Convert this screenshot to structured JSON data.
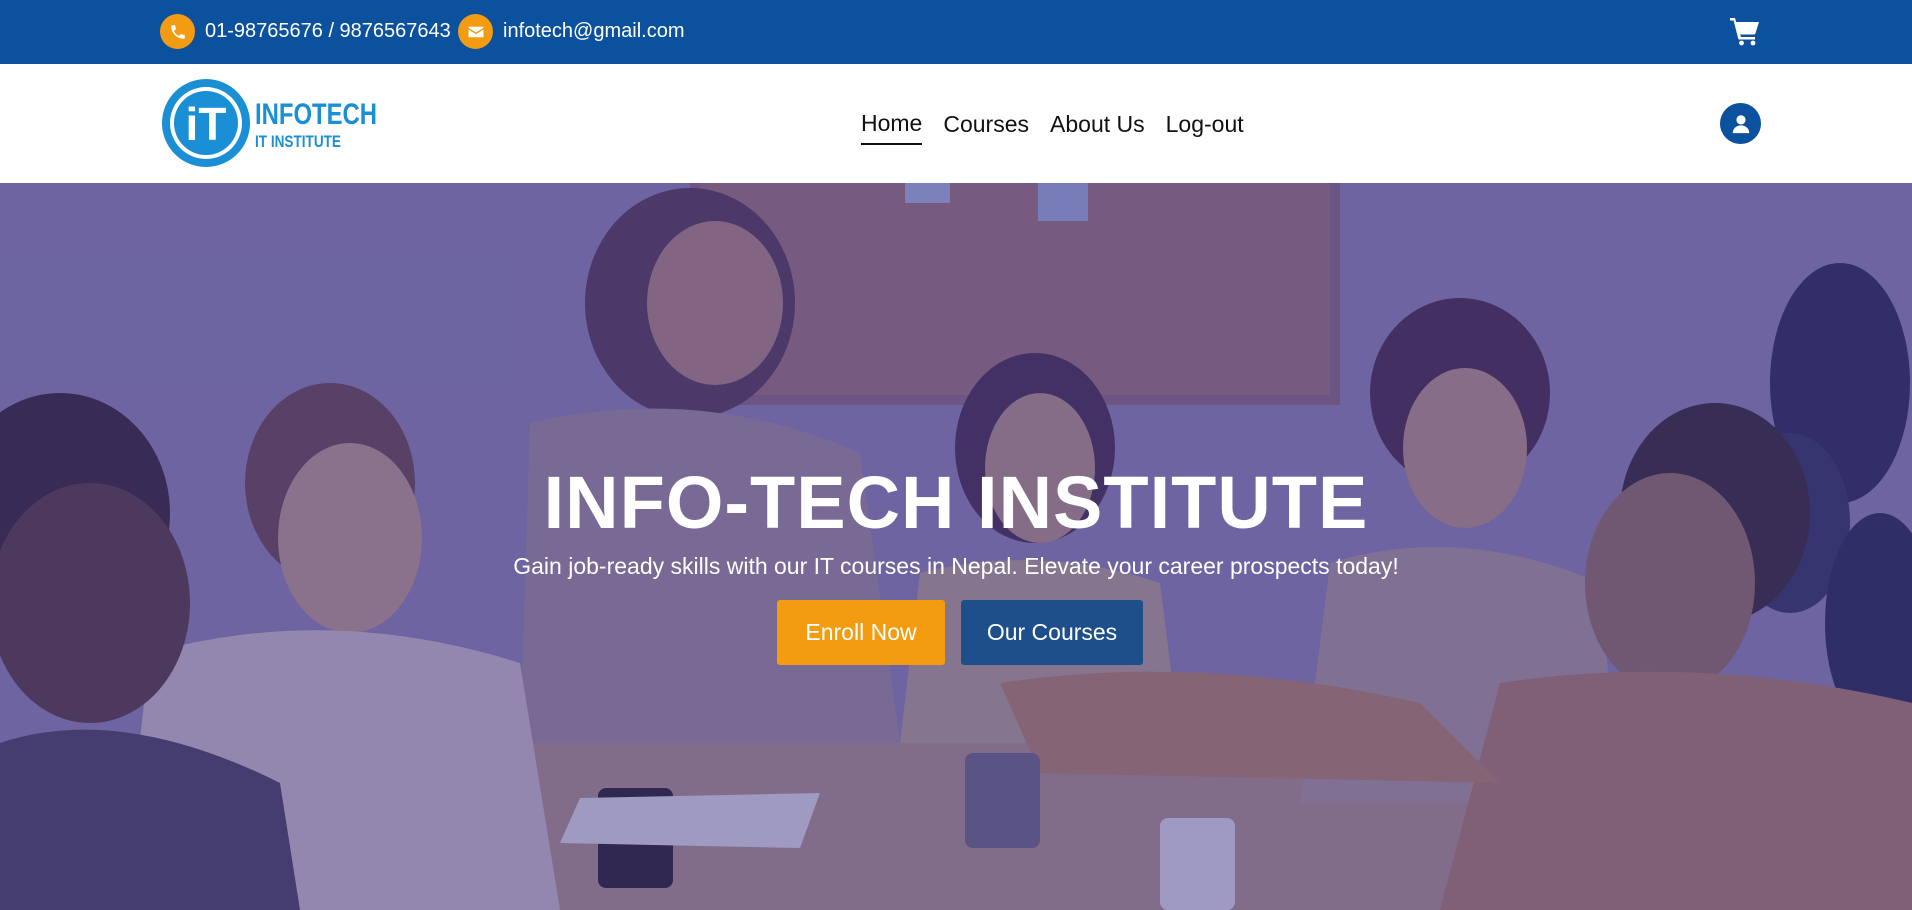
{
  "topbar": {
    "phone_icon": "phone-icon",
    "phone": "01-98765676 / 9876567643",
    "email_icon": "envelope-icon",
    "email": "infotech@gmail.com",
    "cart_icon": "shopping-cart-icon"
  },
  "logo": {
    "mark": "iT",
    "name": "INFOTECH",
    "tagline": "IT INSTITUTE"
  },
  "nav": {
    "items": [
      {
        "label": "Home",
        "active": true
      },
      {
        "label": "Courses",
        "active": false
      },
      {
        "label": "About Us",
        "active": false
      },
      {
        "label": "Log-out",
        "active": false
      }
    ],
    "user_icon": "user-icon"
  },
  "hero": {
    "title": "INFO-TECH INSTITUTE",
    "subtitle": "Gain job-ready skills with our IT courses in Nepal. Elevate your career prospects today!",
    "enroll_label": "Enroll Now",
    "courses_label": "Our Courses"
  },
  "colors": {
    "brand_blue": "#0c519e",
    "accent_orange": "#f39c12",
    "secondary_button": "#1e4f8a",
    "logo_blue": "#1a8fd6"
  }
}
